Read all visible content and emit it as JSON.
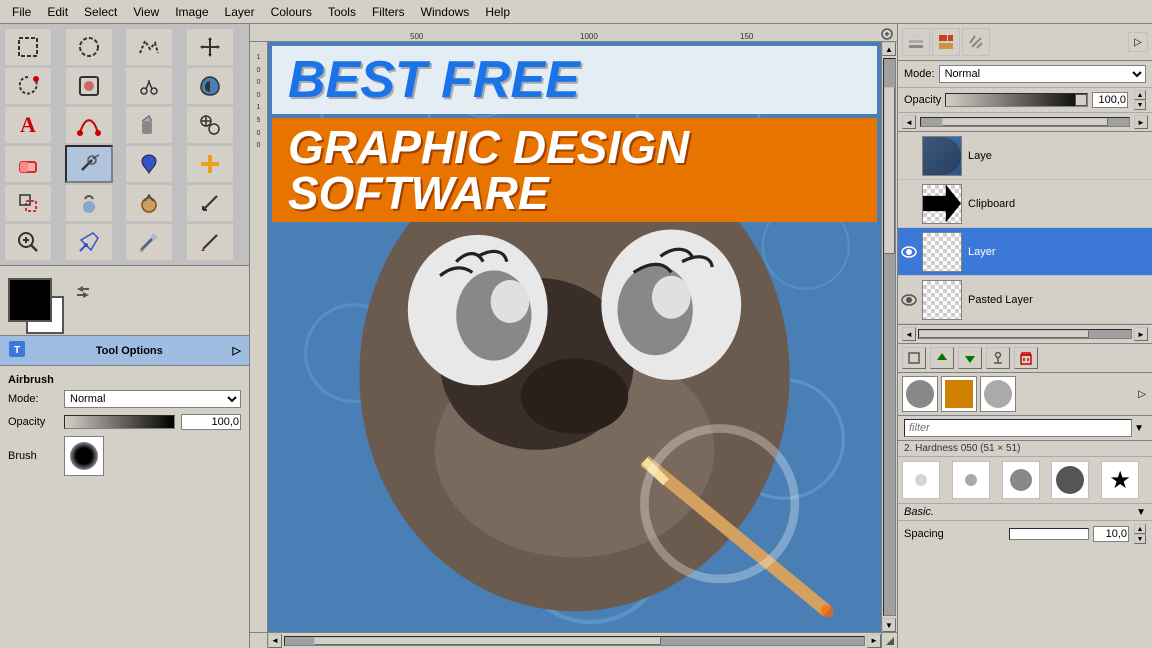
{
  "menu": {
    "items": [
      "File",
      "Edit",
      "Select",
      "View",
      "Image",
      "Layer",
      "Colours",
      "Tools",
      "Filters",
      "Windows",
      "Help"
    ]
  },
  "banner": {
    "line1": "BEST FREE",
    "line2": "GRAPHIC DESIGN SOFTWARE"
  },
  "toolbox": {
    "title": "Tool Options",
    "tool_name": "Airbrush",
    "mode_label": "Mode:",
    "mode_value": "Normal",
    "opacity_label": "Opacity",
    "opacity_value": "100,0",
    "brush_label": "Brush"
  },
  "right_panel": {
    "mode_label": "Mode:",
    "mode_value": "Normal",
    "opacity_label": "Opacity",
    "opacity_value": "100,0",
    "filter_placeholder": "filter",
    "hardness_label": "2. Hardness 050 (51 × 51)",
    "basic_label": "Basic.",
    "spacing_label": "Spacing",
    "spacing_value": "10,0"
  },
  "layers": {
    "items": [
      {
        "name": "Laye",
        "visible": true,
        "active": false
      },
      {
        "name": "Clipboard",
        "visible": true,
        "active": false
      },
      {
        "name": "Layer",
        "visible": true,
        "active": true
      },
      {
        "name": "Pasted Layer",
        "visible": true,
        "active": false
      }
    ]
  },
  "rulers": {
    "top_marks": [
      "500",
      "1000",
      "150"
    ],
    "left_marks": [
      "1",
      "0",
      "0",
      "0",
      "1",
      "5",
      "0",
      "0"
    ]
  }
}
